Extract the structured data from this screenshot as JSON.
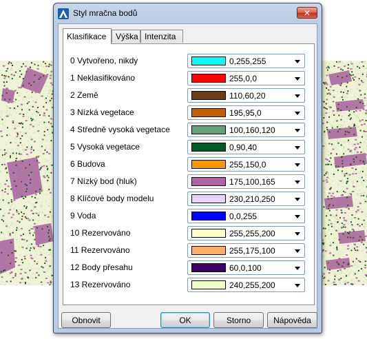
{
  "window": {
    "title": "Styl mračna bodů"
  },
  "tabs": [
    {
      "label": "Klasifikace",
      "active": true
    },
    {
      "label": "Výška",
      "active": false
    },
    {
      "label": "Intenzita",
      "active": false
    }
  ],
  "classes": [
    {
      "label": "0 Vytvořeno, nikdy",
      "value": "0,255,255",
      "color": "#00ffff"
    },
    {
      "label": "1 Neklasifikováno",
      "value": "255,0,0",
      "color": "#ff0000"
    },
    {
      "label": "2 Země",
      "value": "110,60,20",
      "color": "#6e3c14"
    },
    {
      "label": "3 Nízká vegetace",
      "value": "195,95,0",
      "color": "#c35f00"
    },
    {
      "label": "4 Středně vysoká vegetace",
      "value": "100,160,120",
      "color": "#64a078"
    },
    {
      "label": "5 Vysoká vegetace",
      "value": "0,90,40",
      "color": "#005a28"
    },
    {
      "label": "6 Budova",
      "value": "255,150,0",
      "color": "#ff9600"
    },
    {
      "label": "7 Nízký bod (hluk)",
      "value": "175,100,165",
      "color": "#af64a5"
    },
    {
      "label": "8 Klíčové body modelu",
      "value": "230,210,250",
      "color": "#e6d2fa"
    },
    {
      "label": "9 Voda",
      "value": "0,0,255",
      "color": "#0000ff"
    },
    {
      "label": "10 Rezervováno",
      "value": "255,255,200",
      "color": "#ffffc8"
    },
    {
      "label": "11 Rezervováno",
      "value": "255,175,100",
      "color": "#ffaf64"
    },
    {
      "label": "12 Body přesahu",
      "value": "60,0,100",
      "color": "#3c0064"
    },
    {
      "label": "13 Rezervováno",
      "value": "240,255,200",
      "color": "#f0ffc8"
    }
  ],
  "buttons": {
    "reset": "Obnovit",
    "ok": "OK",
    "cancel": "Storno",
    "help": "Nápověda"
  },
  "icons": {
    "app": "autocad-logo-icon",
    "close": "close-icon",
    "dropdown": "chevron-down-icon"
  }
}
